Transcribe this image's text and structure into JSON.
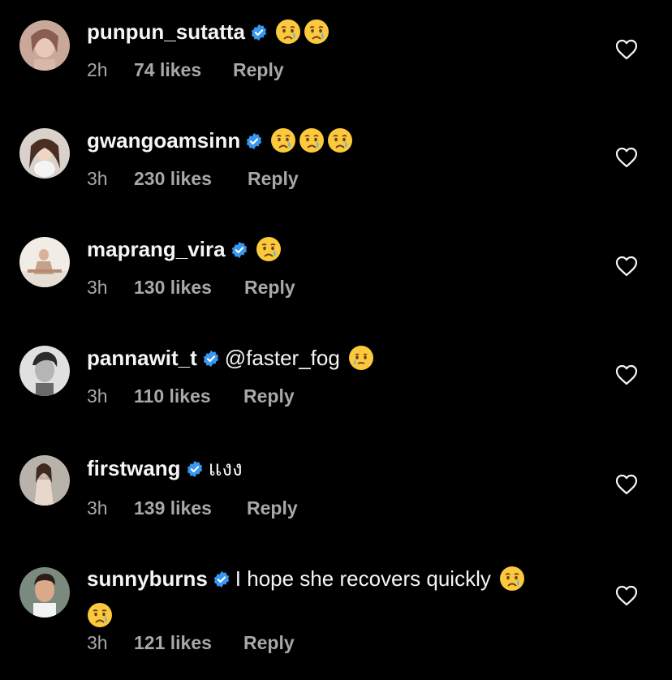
{
  "colors": {
    "background": "#000000",
    "text": "#f5f5f5",
    "meta": "#a8a8a8",
    "verified": "#3897f0"
  },
  "icons": {
    "verified": "verified-badge-icon",
    "like": "heart-outline-icon",
    "emoji": "crying-face-emoji"
  },
  "comments": [
    {
      "username": "punpun_sutatta",
      "text": "",
      "emoji_count": 2,
      "time": "2h",
      "likes": "74 likes",
      "reply": "Reply"
    },
    {
      "username": "gwangoamsinn",
      "text": "",
      "emoji_count": 3,
      "time": "3h",
      "likes": "230 likes",
      "reply": "Reply"
    },
    {
      "username": "maprang_vira",
      "text": "",
      "emoji_count": 1,
      "time": "3h",
      "likes": "130 likes",
      "reply": "Reply"
    },
    {
      "username": "pannawit_t",
      "text": "@faster_fog",
      "emoji_count": 1,
      "time": "3h",
      "likes": "110 likes",
      "reply": "Reply"
    },
    {
      "username": "firstwang",
      "text": "แงง",
      "emoji_count": 0,
      "time": "3h",
      "likes": "139 likes",
      "reply": "Reply"
    },
    {
      "username": "sunnyburns",
      "text": "I hope she recovers quickly",
      "emoji_count": 2,
      "time": "3h",
      "likes": "121 likes",
      "reply": "Reply"
    }
  ]
}
